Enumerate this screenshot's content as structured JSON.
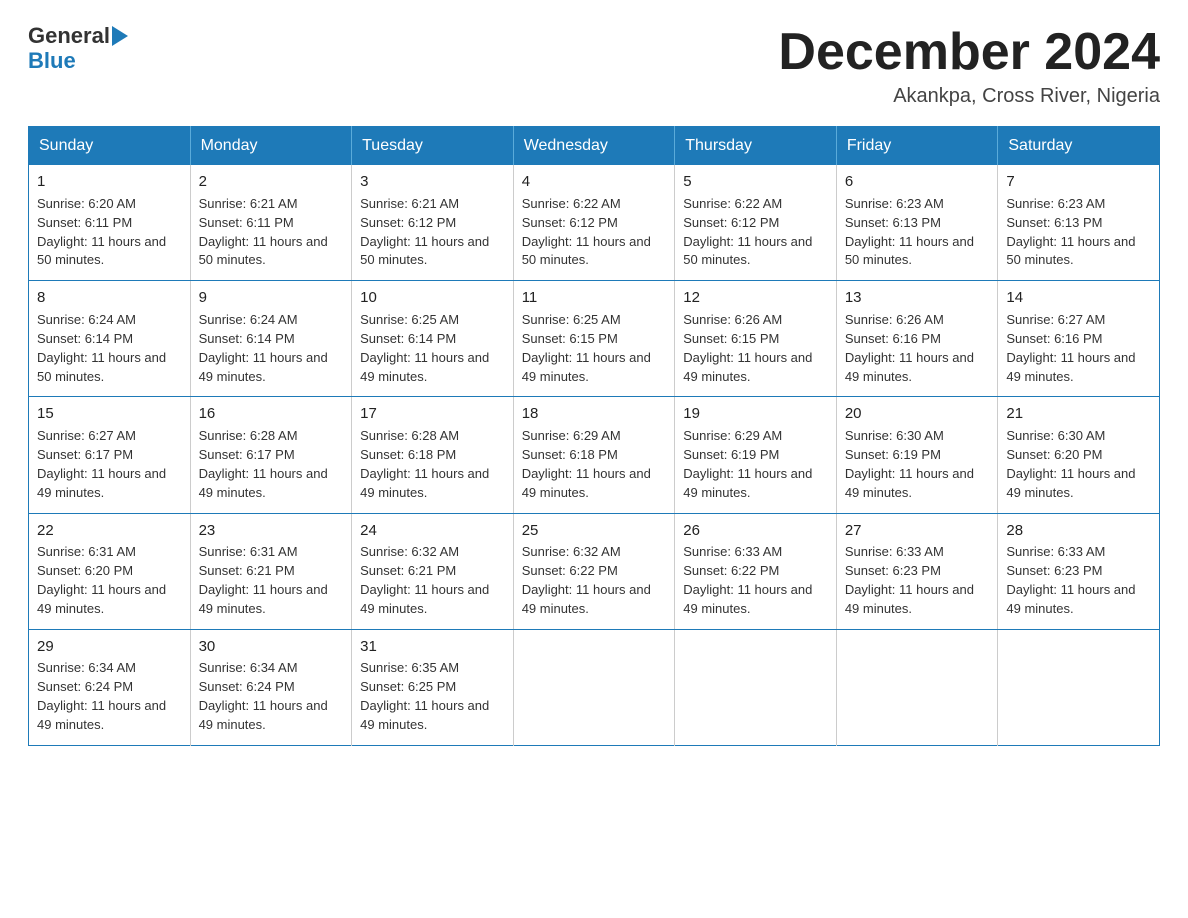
{
  "header": {
    "logo_general": "General",
    "logo_blue": "Blue",
    "month_title": "December 2024",
    "location": "Akankpa, Cross River, Nigeria"
  },
  "days_of_week": [
    "Sunday",
    "Monday",
    "Tuesday",
    "Wednesday",
    "Thursday",
    "Friday",
    "Saturday"
  ],
  "weeks": [
    [
      {
        "day": "1",
        "sunrise": "6:20 AM",
        "sunset": "6:11 PM",
        "daylight": "11 hours and 50 minutes."
      },
      {
        "day": "2",
        "sunrise": "6:21 AM",
        "sunset": "6:11 PM",
        "daylight": "11 hours and 50 minutes."
      },
      {
        "day": "3",
        "sunrise": "6:21 AM",
        "sunset": "6:12 PM",
        "daylight": "11 hours and 50 minutes."
      },
      {
        "day": "4",
        "sunrise": "6:22 AM",
        "sunset": "6:12 PM",
        "daylight": "11 hours and 50 minutes."
      },
      {
        "day": "5",
        "sunrise": "6:22 AM",
        "sunset": "6:12 PM",
        "daylight": "11 hours and 50 minutes."
      },
      {
        "day": "6",
        "sunrise": "6:23 AM",
        "sunset": "6:13 PM",
        "daylight": "11 hours and 50 minutes."
      },
      {
        "day": "7",
        "sunrise": "6:23 AM",
        "sunset": "6:13 PM",
        "daylight": "11 hours and 50 minutes."
      }
    ],
    [
      {
        "day": "8",
        "sunrise": "6:24 AM",
        "sunset": "6:14 PM",
        "daylight": "11 hours and 50 minutes."
      },
      {
        "day": "9",
        "sunrise": "6:24 AM",
        "sunset": "6:14 PM",
        "daylight": "11 hours and 49 minutes."
      },
      {
        "day": "10",
        "sunrise": "6:25 AM",
        "sunset": "6:14 PM",
        "daylight": "11 hours and 49 minutes."
      },
      {
        "day": "11",
        "sunrise": "6:25 AM",
        "sunset": "6:15 PM",
        "daylight": "11 hours and 49 minutes."
      },
      {
        "day": "12",
        "sunrise": "6:26 AM",
        "sunset": "6:15 PM",
        "daylight": "11 hours and 49 minutes."
      },
      {
        "day": "13",
        "sunrise": "6:26 AM",
        "sunset": "6:16 PM",
        "daylight": "11 hours and 49 minutes."
      },
      {
        "day": "14",
        "sunrise": "6:27 AM",
        "sunset": "6:16 PM",
        "daylight": "11 hours and 49 minutes."
      }
    ],
    [
      {
        "day": "15",
        "sunrise": "6:27 AM",
        "sunset": "6:17 PM",
        "daylight": "11 hours and 49 minutes."
      },
      {
        "day": "16",
        "sunrise": "6:28 AM",
        "sunset": "6:17 PM",
        "daylight": "11 hours and 49 minutes."
      },
      {
        "day": "17",
        "sunrise": "6:28 AM",
        "sunset": "6:18 PM",
        "daylight": "11 hours and 49 minutes."
      },
      {
        "day": "18",
        "sunrise": "6:29 AM",
        "sunset": "6:18 PM",
        "daylight": "11 hours and 49 minutes."
      },
      {
        "day": "19",
        "sunrise": "6:29 AM",
        "sunset": "6:19 PM",
        "daylight": "11 hours and 49 minutes."
      },
      {
        "day": "20",
        "sunrise": "6:30 AM",
        "sunset": "6:19 PM",
        "daylight": "11 hours and 49 minutes."
      },
      {
        "day": "21",
        "sunrise": "6:30 AM",
        "sunset": "6:20 PM",
        "daylight": "11 hours and 49 minutes."
      }
    ],
    [
      {
        "day": "22",
        "sunrise": "6:31 AM",
        "sunset": "6:20 PM",
        "daylight": "11 hours and 49 minutes."
      },
      {
        "day": "23",
        "sunrise": "6:31 AM",
        "sunset": "6:21 PM",
        "daylight": "11 hours and 49 minutes."
      },
      {
        "day": "24",
        "sunrise": "6:32 AM",
        "sunset": "6:21 PM",
        "daylight": "11 hours and 49 minutes."
      },
      {
        "day": "25",
        "sunrise": "6:32 AM",
        "sunset": "6:22 PM",
        "daylight": "11 hours and 49 minutes."
      },
      {
        "day": "26",
        "sunrise": "6:33 AM",
        "sunset": "6:22 PM",
        "daylight": "11 hours and 49 minutes."
      },
      {
        "day": "27",
        "sunrise": "6:33 AM",
        "sunset": "6:23 PM",
        "daylight": "11 hours and 49 minutes."
      },
      {
        "day": "28",
        "sunrise": "6:33 AM",
        "sunset": "6:23 PM",
        "daylight": "11 hours and 49 minutes."
      }
    ],
    [
      {
        "day": "29",
        "sunrise": "6:34 AM",
        "sunset": "6:24 PM",
        "daylight": "11 hours and 49 minutes."
      },
      {
        "day": "30",
        "sunrise": "6:34 AM",
        "sunset": "6:24 PM",
        "daylight": "11 hours and 49 minutes."
      },
      {
        "day": "31",
        "sunrise": "6:35 AM",
        "sunset": "6:25 PM",
        "daylight": "11 hours and 49 minutes."
      },
      null,
      null,
      null,
      null
    ]
  ]
}
